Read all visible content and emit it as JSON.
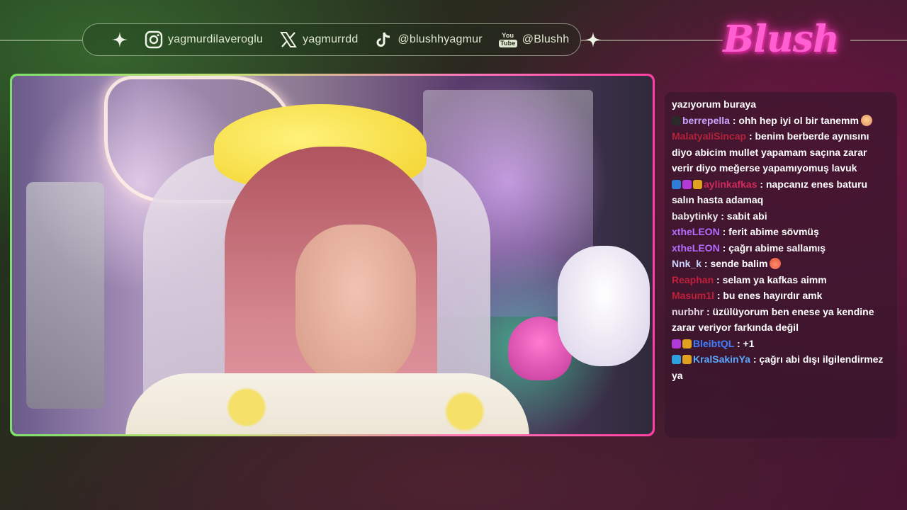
{
  "social": {
    "instagram": "yagmurdilaveroglu",
    "x": "yagmurrdd",
    "tiktok": "@blushhyagmur",
    "youtube_badge_top": "You",
    "youtube_badge_bottom": "Tube",
    "youtube": "@Blushh",
    "icons": [
      "sparkle-icon",
      "instagram-icon",
      "x-icon",
      "tiktok-icon",
      "youtube-icon",
      "sparkle-icon"
    ]
  },
  "logo_text": "Blush",
  "colors": {
    "accent_green": "#7ee06a",
    "accent_pink": "#ff3fa3",
    "logo_pink": "#ff5fd0",
    "chat_bg": "#3a162c"
  },
  "chat": [
    {
      "user": "",
      "text": "yazıyorum buraya",
      "user_color": "#ffffff",
      "badges": [],
      "emoji": ""
    },
    {
      "user": "berrepella",
      "text": ": ohh hep iyi ol bir tanemm",
      "user_color": "#c9a3ff",
      "badges": [
        "#2a2a2a"
      ],
      "emoji": "face-emoji"
    },
    {
      "user": "MalatyaliSincap",
      "text": ": benim berberde aynısını diyo abicim mullet yapamam saçına zarar verir diyo meğerse yapamıyomuş lavuk",
      "user_color": "#b2223a",
      "badges": [],
      "emoji": ""
    },
    {
      "user": "aylinkafkas",
      "text": ": napcanız enes baturu salın hasta adamaq",
      "user_color": "#d02a5a",
      "badges": [
        "#2e7dd8",
        "#b23ad6",
        "#e0a020"
      ],
      "emoji": ""
    },
    {
      "user": "babytinky",
      "text": ": sabit abi",
      "user_color": "#e8e8e8",
      "badges": [],
      "emoji": ""
    },
    {
      "user": "xtheLEON",
      "text": ": ferit abime sövmüş",
      "user_color": "#b56cff",
      "badges": [],
      "emoji": ""
    },
    {
      "user": "xtheLEON",
      "text": ": çağrı abime sallamış",
      "user_color": "#b56cff",
      "badges": [],
      "emoji": ""
    },
    {
      "user": "Nnk_k",
      "text": ": sende balim",
      "user_color": "#c9d2ff",
      "badges": [],
      "emoji": "cake-emoji"
    },
    {
      "user": "Reaphan",
      "text": ": selam ya kafkas aimm",
      "user_color": "#c21f3a",
      "badges": [],
      "emoji": ""
    },
    {
      "user": "Masum1l",
      "text": ": bu enes hayırdır amk",
      "user_color": "#c21f3a",
      "badges": [],
      "emoji": ""
    },
    {
      "user": "nurbhr",
      "text": ": üzülüyorum ben enese ya kendine zarar veriyor farkında değil",
      "user_color": "#e0d0e0",
      "badges": [],
      "emoji": ""
    },
    {
      "user": "BleibtQL",
      "text": ": +1",
      "user_color": "#3f7fff",
      "badges": [
        "#b23ad6",
        "#e0a020"
      ],
      "emoji": ""
    },
    {
      "user": "KralSakinYa",
      "text": ": çağrı abi dışı ilgilendirmez ya",
      "user_color": "#5aa8ff",
      "badges": [
        "#2ea0e0",
        "#e0a020"
      ],
      "emoji": ""
    }
  ]
}
